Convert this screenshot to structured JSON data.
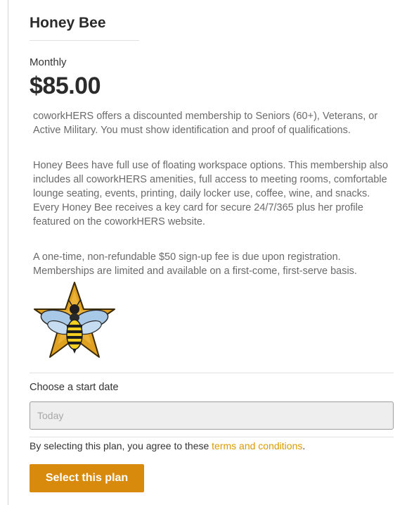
{
  "plan": {
    "title": "Honey Bee",
    "period": "Monthly",
    "price": "$85.00",
    "descriptions": [
      "coworkHERS offers a discounted membership to Seniors (60+), Veterans, or Active Military. You must show identification and proof of qualifications.",
      "Honey Bees have full use of floating workspace options. This membership also includes all coworkHERS amenities, full access to meeting rooms, comfortable lounge seating, events, printing, daily locker use, coffee, wine, and snacks. Every Honey Bee receives a key card for secure 24/7/365 plus her profile featured on the coworkHERS website.",
      "A one-time, non-refundable $50 sign-up fee is due upon registration. Memberships are limited and available on a first-come, first-serve basis."
    ],
    "badge_icon": "honey-bee-star-badge"
  },
  "start_date": {
    "label": "Choose a start date",
    "placeholder": "Today",
    "value": ""
  },
  "agreement": {
    "prefix": "By selecting this plan, you agree to these ",
    "link_text": "terms and conditions",
    "suffix": "."
  },
  "actions": {
    "select_label": "Select this plan"
  },
  "colors": {
    "accent": "#d88a0c",
    "link": "#d99a00",
    "badge_gold": "#e0a020",
    "wing_blue": "#a8c8e8"
  }
}
